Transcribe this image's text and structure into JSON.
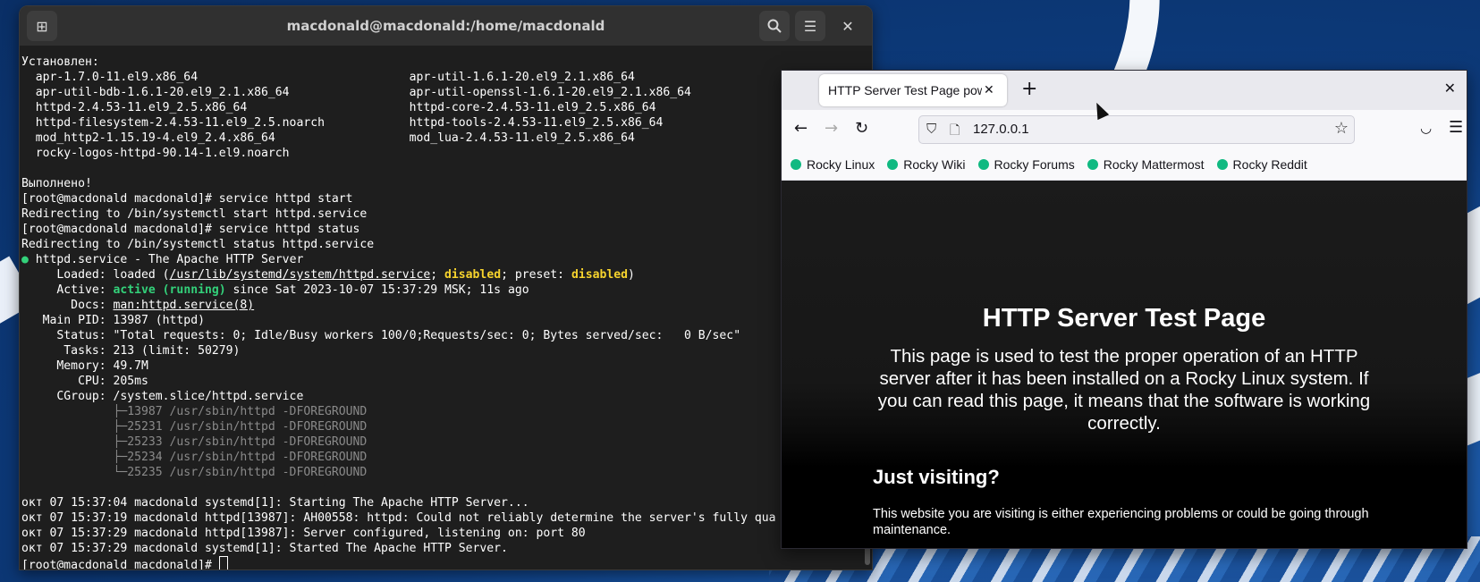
{
  "terminal": {
    "title": "macdonald@macdonald:/home/macdonald",
    "lines": [
      [
        {
          "t": "Установлен:"
        }
      ],
      [
        {
          "t": "  apr-1.7.0-11.el9.x86_64                              apr-util-1.6.1-20.el9_2.1.x86_64"
        }
      ],
      [
        {
          "t": "  apr-util-bdb-1.6.1-20.el9_2.1.x86_64                 apr-util-openssl-1.6.1-20.el9_2.1.x86_64"
        }
      ],
      [
        {
          "t": "  httpd-2.4.53-11.el9_2.5.x86_64                       httpd-core-2.4.53-11.el9_2.5.x86_64"
        }
      ],
      [
        {
          "t": "  httpd-filesystem-2.4.53-11.el9_2.5.noarch            httpd-tools-2.4.53-11.el9_2.5.x86_64"
        }
      ],
      [
        {
          "t": "  mod_http2-1.15.19-4.el9_2.4.x86_64                   mod_lua-2.4.53-11.el9_2.5.x86_64"
        }
      ],
      [
        {
          "t": "  rocky-logos-httpd-90.14-1.el9.noarch"
        }
      ],
      [
        {
          "t": ""
        }
      ],
      [
        {
          "t": "Выполнено!"
        }
      ],
      [
        {
          "t": "[root@macdonald macdonald]# service httpd start"
        }
      ],
      [
        {
          "t": "Redirecting to /bin/systemctl start httpd.service"
        }
      ],
      [
        {
          "t": "[root@macdonald macdonald]# service httpd status"
        }
      ],
      [
        {
          "t": "Redirecting to /bin/systemctl status httpd.service"
        }
      ],
      [
        {
          "t": "●",
          "c": "g"
        },
        {
          "t": " httpd.service - The Apache HTTP Server"
        }
      ],
      [
        {
          "t": "     Loaded: loaded ("
        },
        {
          "t": "/usr/lib/systemd/system/httpd.service",
          "c": "ul"
        },
        {
          "t": "; "
        },
        {
          "t": "disabled",
          "c": "y"
        },
        {
          "t": "; preset: "
        },
        {
          "t": "disabled",
          "c": "y"
        },
        {
          "t": ")"
        }
      ],
      [
        {
          "t": "     Active: "
        },
        {
          "t": "active (running)",
          "c": "g"
        },
        {
          "t": " since Sat 2023-10-07 15:37:29 MSK; 11s ago"
        }
      ],
      [
        {
          "t": "       Docs: "
        },
        {
          "t": "man:httpd.service(8)",
          "c": "ul"
        }
      ],
      [
        {
          "t": "   Main PID: 13987 (httpd)"
        }
      ],
      [
        {
          "t": "     Status: \"Total requests: 0; Idle/Busy workers 100/0;Requests/sec: 0; Bytes served/sec:   0 B/sec\""
        }
      ],
      [
        {
          "t": "      Tasks: 213 (limit: 50279)"
        }
      ],
      [
        {
          "t": "     Memory: 49.7M"
        }
      ],
      [
        {
          "t": "        CPU: 205ms"
        }
      ],
      [
        {
          "t": "     CGroup: /system.slice/httpd.service"
        }
      ],
      [
        {
          "t": "             ├─13987 /usr/sbin/httpd -DFOREGROUND",
          "c": "dim"
        }
      ],
      [
        {
          "t": "             ├─25231 /usr/sbin/httpd -DFOREGROUND",
          "c": "dim"
        }
      ],
      [
        {
          "t": "             ├─25233 /usr/sbin/httpd -DFOREGROUND",
          "c": "dim"
        }
      ],
      [
        {
          "t": "             ├─25234 /usr/sbin/httpd -DFOREGROUND",
          "c": "dim"
        }
      ],
      [
        {
          "t": "             └─25235 /usr/sbin/httpd -DFOREGROUND",
          "c": "dim"
        }
      ],
      [
        {
          "t": ""
        }
      ],
      [
        {
          "t": "окт 07 15:37:04 macdonald systemd[1]: Starting The Apache HTTP Server..."
        }
      ],
      [
        {
          "t": "окт 07 15:37:19 macdonald httpd[13987]: AH00558: httpd: Could not reliably determine the server's fully qua"
        }
      ],
      [
        {
          "t": "окт 07 15:37:29 macdonald httpd[13987]: Server configured, listening on: port 80"
        }
      ],
      [
        {
          "t": "окт 07 15:37:29 macdonald systemd[1]: Started The Apache HTTP Server."
        }
      ],
      [
        {
          "t": "[root@macdonald macdonald]# "
        }
      ]
    ]
  },
  "browser": {
    "tab_title": "HTTP Server Test Page powered by Rocky Linux",
    "url": "127.0.0.1",
    "bookmarks": [
      "Rocky Linux",
      "Rocky Wiki",
      "Rocky Forums",
      "Rocky Mattermost",
      "Rocky Reddit"
    ],
    "page": {
      "title": "HTTP Server Test Page",
      "intro": "This page is used to test the proper operation of an HTTP server after it has been installed on a Rocky Linux system. If you can read this page, it means that the software is working correctly.",
      "heading": "Just visiting?",
      "text": "This website you are visiting is either experiencing problems or could be going through maintenance."
    }
  },
  "colors": {
    "terminal_bg": "#1e1e1e",
    "green": "#33d17a",
    "yellow": "#f6d32d",
    "bookmark_icon": "#10b981"
  }
}
